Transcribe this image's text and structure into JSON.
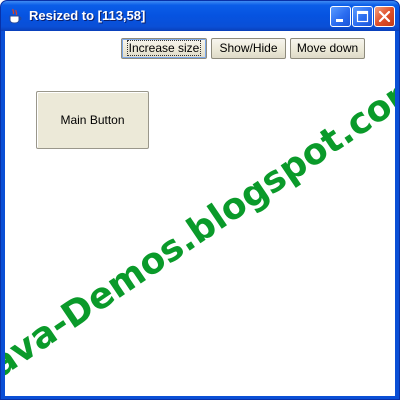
{
  "window": {
    "title": "Resized to [113,58]",
    "icons": {
      "app": "java-cup-icon",
      "minimize": "minimize-icon",
      "maximize": "maximize-icon",
      "close": "close-icon"
    }
  },
  "toolbar": {
    "buttons": [
      {
        "label": "Increase size"
      },
      {
        "label": "Show/Hide"
      },
      {
        "label": "Move down"
      }
    ]
  },
  "main_button": {
    "label": "Main Button",
    "size_text": "[113,58]"
  },
  "watermark": {
    "text": "Java-Demos.blogspot.com",
    "color": "#0a9a2a"
  },
  "colors": {
    "titlebar": "#0a4fd6",
    "button_face": "#ece9d8",
    "close_button": "#e0502a"
  }
}
